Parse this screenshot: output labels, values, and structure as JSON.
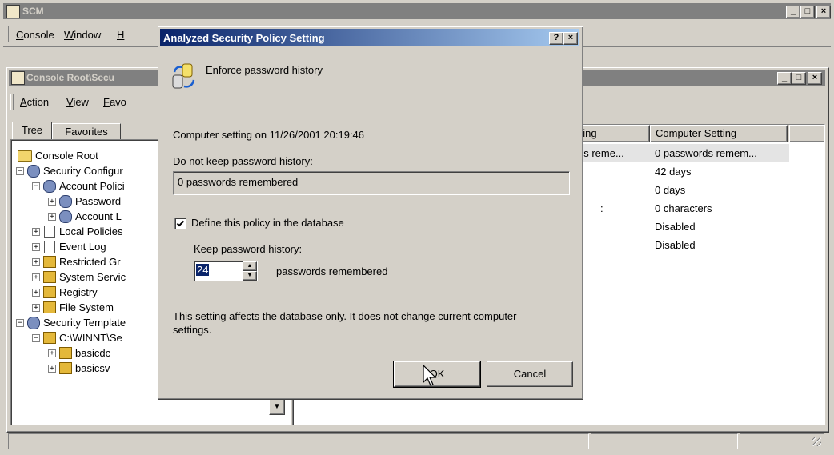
{
  "app": {
    "title": "SCM",
    "menu": [
      {
        "label": "Console",
        "access": "C"
      },
      {
        "label": "Window",
        "access": "W"
      },
      {
        "label": "H",
        "access": "H"
      }
    ]
  },
  "mdi": {
    "title": "Console Root\\Secu",
    "menu": [
      {
        "label": "Action",
        "access": "A"
      },
      {
        "label": "View",
        "access": "V"
      },
      {
        "label": "Favo",
        "access": "F"
      }
    ],
    "tabs": {
      "tree": "Tree",
      "favorites": "Favorites"
    },
    "tree": [
      {
        "label": "Console Root",
        "icon": "folder-icon"
      },
      {
        "label": "Security Configur",
        "icon": "security-config-icon"
      },
      {
        "label": "Account Polici",
        "icon": "policy-icon"
      },
      {
        "label": "Password",
        "icon": "policy-icon"
      },
      {
        "label": "Account L",
        "icon": "policy-icon"
      },
      {
        "label": "Local Policies",
        "icon": "local-policy-icon"
      },
      {
        "label": "Event Log",
        "icon": "event-log-icon"
      },
      {
        "label": "Restricted Gr",
        "icon": "restricted-groups-icon"
      },
      {
        "label": "System Servic",
        "icon": "system-services-icon"
      },
      {
        "label": "Registry",
        "icon": "registry-icon"
      },
      {
        "label": "File System",
        "icon": "file-system-icon"
      },
      {
        "label": "Security Template",
        "icon": "security-templates-icon"
      },
      {
        "label": "C:\\WINNT\\Se",
        "icon": "template-folder-icon"
      },
      {
        "label": "basicdc",
        "icon": "template-icon"
      },
      {
        "label": "basicsv",
        "icon": "template-icon"
      }
    ],
    "columns": {
      "database": "tting",
      "computer": "Computer Setting"
    },
    "rows": [
      {
        "database": "ds reme...",
        "computer": "0 passwords remem..."
      },
      {
        "database": "",
        "computer": "42 days"
      },
      {
        "database": "",
        "computer": "0 days"
      },
      {
        "database": ":",
        "computer": "0 characters"
      },
      {
        "database": "",
        "computer": "Disabled"
      },
      {
        "database": "",
        "computer": "Disabled"
      }
    ]
  },
  "dialog": {
    "title": "Analyzed Security Policy Setting",
    "help_glyph": "?",
    "close_glyph": "×",
    "policy_name": "Enforce password history",
    "computer_setting_caption": "Computer setting on 11/26/2001 20:19:46",
    "current_label": "Do not keep password history:",
    "current_value": "0 passwords remembered",
    "define_label": "Define this policy in the database",
    "define_checked": true,
    "keep_label": "Keep password history:",
    "keep_value": "24",
    "keep_suffix": "passwords remembered",
    "note": "This setting affects the database only. It does not change current computer settings.",
    "ok_label": "OK",
    "cancel_label": "Cancel"
  },
  "colors": {
    "face": "#d4d0c8",
    "active_title": "#0a246a",
    "inactive_title": "#808080"
  }
}
